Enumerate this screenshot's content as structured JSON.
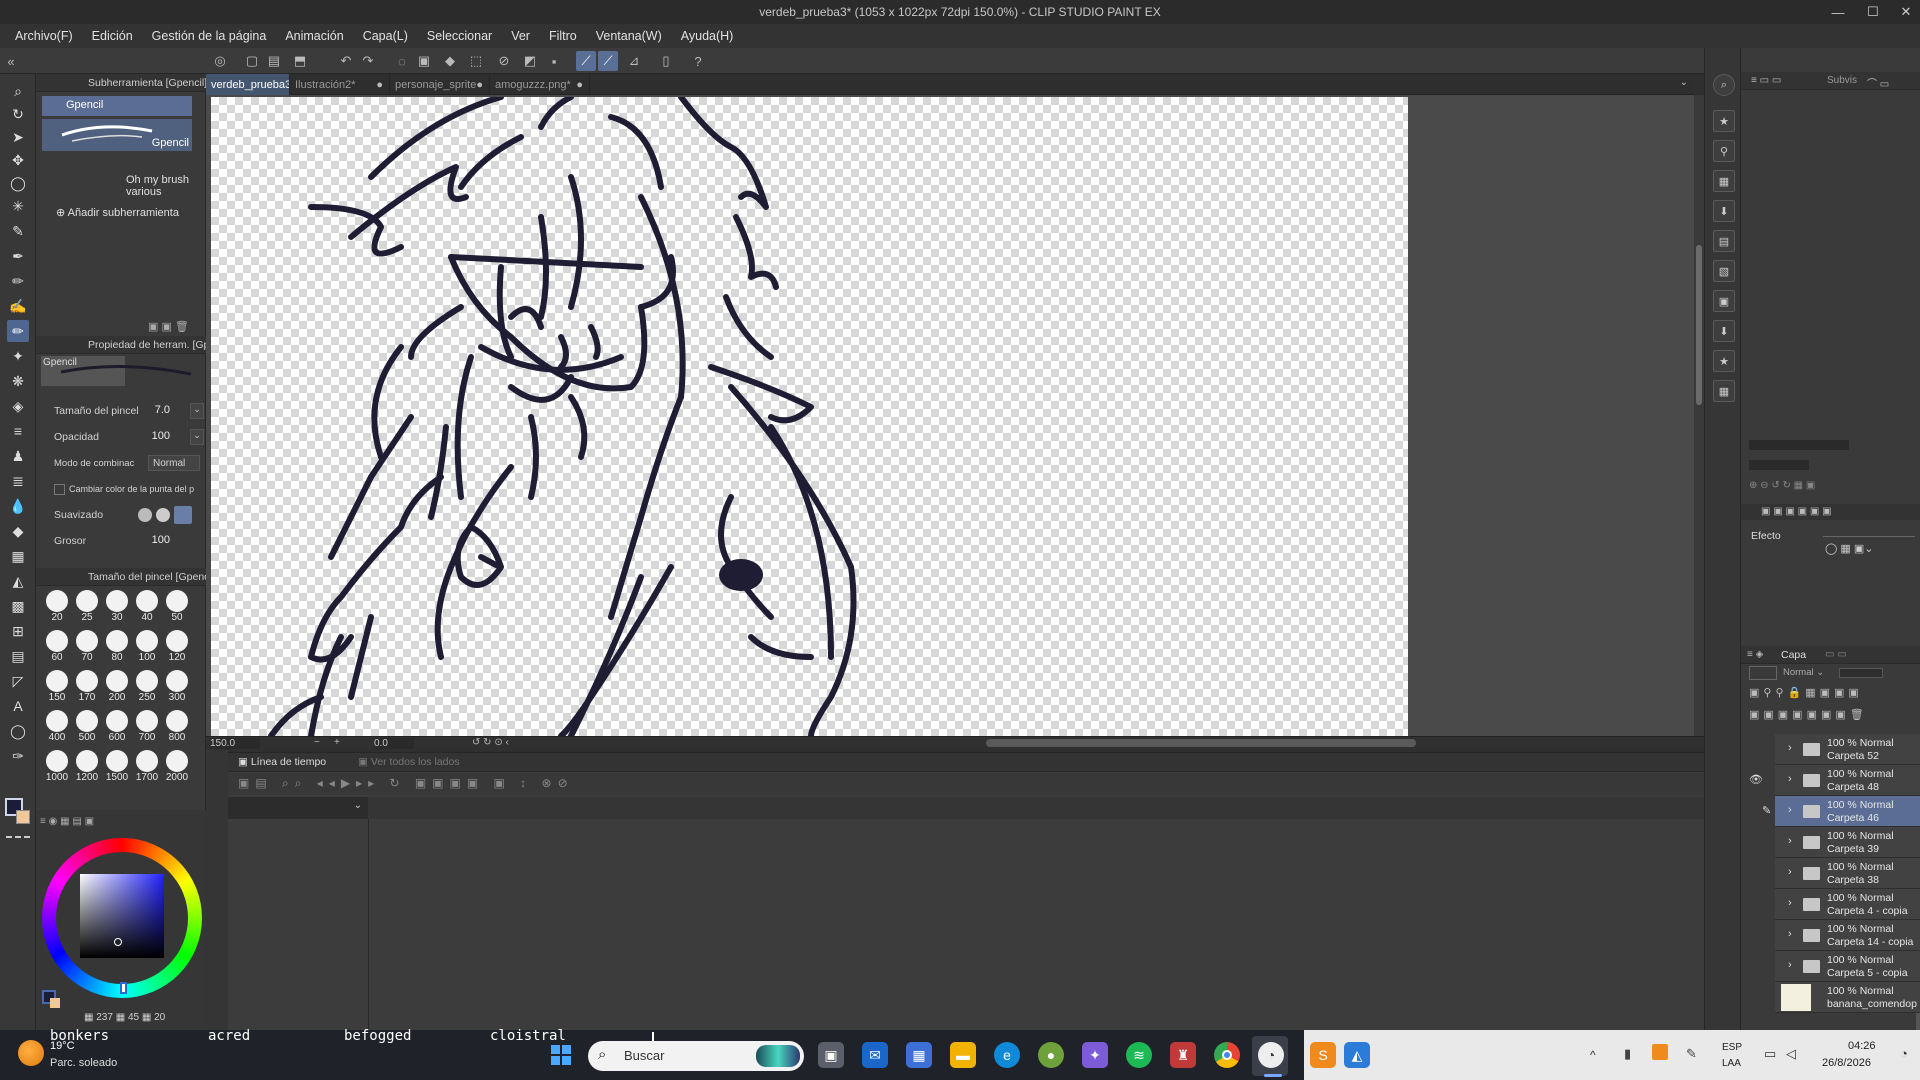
{
  "titlebar": {
    "title": "verdeb_prueba3* (1053 x 1022px 72dpi 150.0%)  - CLIP STUDIO PAINT EX",
    "minimize": "—",
    "maximize": "☐",
    "close": "✕"
  },
  "menu": [
    "Archivo(F)",
    "Edición",
    "Gestión de la página",
    "Animación",
    "Capa(L)",
    "Seleccionar",
    "Ver",
    "Filtro",
    "Ventana(W)",
    "Ayuda(H)"
  ],
  "subtool": {
    "header": "Subherramienta [Gpencil]",
    "selected": "Gpencil",
    "preview_label": "Gpencil",
    "set_name": "Oh my brush various",
    "add": "Añadir subherramienta"
  },
  "toolprop": {
    "header": "Propiedad de herram. [Gpe",
    "preview_label": "Gpencil",
    "size_label": "Tamaño del pincel",
    "size_value": "7.0",
    "opacity_label": "Opacidad",
    "opacity_value": "100",
    "blend_label": "Modo de combinac",
    "blend_value": "Normal",
    "tipcolor_label": "Cambiar color de la punta del p",
    "smooth_label": "Suavizado",
    "thickness_label": "Grosor",
    "thickness_value": "100"
  },
  "brushsize": {
    "header": "Tamaño del pincel [Gpenc",
    "sizes": [
      "20",
      "25",
      "30",
      "40",
      "50",
      "60",
      "70",
      "80",
      "100",
      "120",
      "150",
      "170",
      "200",
      "250",
      "300",
      "400",
      "500",
      "600",
      "700",
      "800",
      "1000",
      "1200",
      "1500",
      "1700",
      "2000"
    ]
  },
  "colorpanel": {
    "readout_1": "237",
    "readout_2": "45",
    "readout_3": "20",
    "main_color": "#1c1c3a",
    "sub_color": "#f0c89a"
  },
  "tabs": [
    {
      "label": "verdeb_prueba3*",
      "active": true
    },
    {
      "label": "Ilustración2*",
      "active": false
    },
    {
      "label": "personaje_sprite",
      "active": false
    },
    {
      "label": "amoguzzz.png*",
      "active": false
    }
  ],
  "nav": {
    "zoom": "150.0",
    "rotation": "0.0"
  },
  "timeline": {
    "tab1": "Línea de tiempo",
    "tab2": "Ver todos los lados"
  },
  "rightpanel": {
    "subview_tab": "Subvis",
    "effect_label": "Efecto",
    "layer_tab": "Capa",
    "blend_mode": "Normal"
  },
  "layers": [
    {
      "opacity": "100 % Normal",
      "name": "Carpeta 52",
      "selected": false,
      "visible": false
    },
    {
      "opacity": "100 % Normal",
      "name": "Carpeta 48",
      "selected": false,
      "visible": true
    },
    {
      "opacity": "100 % Normal",
      "name": "Carpeta 46",
      "selected": true,
      "visible": false
    },
    {
      "opacity": "100 % Normal",
      "name": "Carpeta 39",
      "selected": false,
      "visible": false
    },
    {
      "opacity": "100 % Normal",
      "name": "Carpeta 38",
      "selected": false,
      "visible": false
    },
    {
      "opacity": "100 % Normal",
      "name": "Carpeta 4 - copia",
      "selected": false,
      "visible": false
    },
    {
      "opacity": "100 % Normal",
      "name": "Carpeta 14 - copia",
      "selected": false,
      "visible": false
    },
    {
      "opacity": "100 % Normal",
      "name": "Carpeta 5 - copia",
      "selected": false,
      "visible": false
    },
    {
      "opacity": "100 % Normal",
      "name": "banana_comendop",
      "selected": false,
      "visible": false
    }
  ],
  "taskbar": {
    "weather_temp": "19°C",
    "weather_desc": "Parc. soleado",
    "overlay_words": [
      "bonkers",
      "acred",
      "befogged",
      "cloistral"
    ],
    "search_placeholder": "Buscar",
    "lang_1": "ESP",
    "lang_2": "LAA",
    "time": "04:26",
    "date": "26/8/2026"
  }
}
